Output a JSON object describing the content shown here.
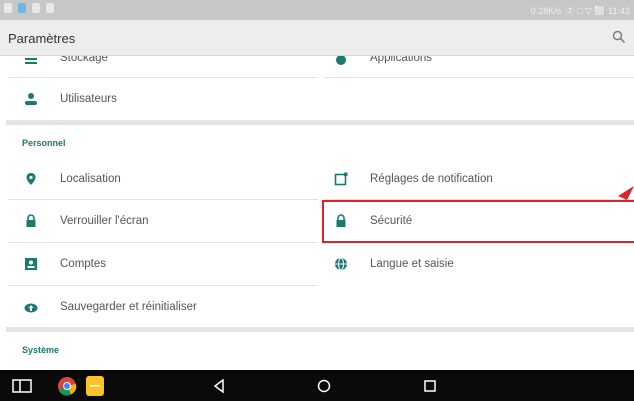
{
  "statusbar": {
    "right_text": "0.28K/s  Ⓩ □ ▽ ⬜ 11:43"
  },
  "toolbar": {
    "title": "Paramètres",
    "search_icon": "search-icon"
  },
  "rows": {
    "stockage": "Stockage",
    "applications": "Applications",
    "utilisateurs": "Utilisateurs",
    "localisation": "Localisation",
    "notifications": "Réglages de notification",
    "verrouiller": "Verrouiller l'écran",
    "securite": "Sécurité",
    "comptes": "Comptes",
    "langue": "Langue et saisie",
    "sauvegarder": "Sauvegarder et réinitialiser"
  },
  "sections": {
    "personnel": "Personnel",
    "systeme": "Système"
  },
  "colors": {
    "accent": "#1b7a6e",
    "highlight": "#d9252a"
  }
}
